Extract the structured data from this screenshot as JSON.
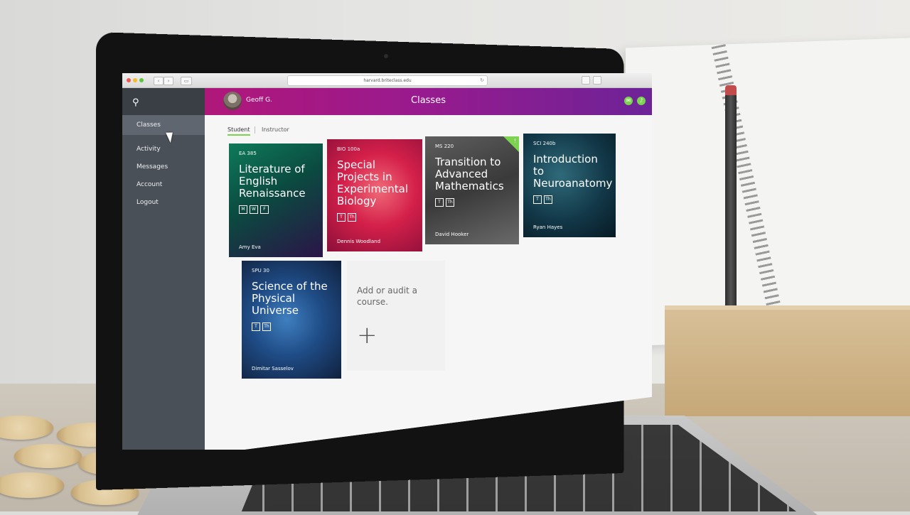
{
  "browser": {
    "url": "harvard.briteclass.edu"
  },
  "header": {
    "user_name": "Geoff G.",
    "title": "Classes"
  },
  "sidebar": {
    "items": [
      {
        "label": "Classes",
        "active": true
      },
      {
        "label": "Activity"
      },
      {
        "label": "Messages"
      },
      {
        "label": "Account"
      },
      {
        "label": "Logout"
      }
    ]
  },
  "tabs": [
    {
      "label": "Student",
      "active": true
    },
    {
      "label": "Instructor"
    }
  ],
  "courses": [
    {
      "code": "EA 385",
      "title": "Literature of English Renaissance",
      "days": [
        "M",
        "W",
        "F"
      ],
      "instructor": "Amy Eva"
    },
    {
      "code": "BIO 100a",
      "title": "Special Projects in Experimental Biology",
      "days": [
        "T",
        "Th"
      ],
      "instructor": "Dennis Woodland"
    },
    {
      "code": "MS 220",
      "title": "Transition to Advanced Mathematics",
      "days": [
        "T",
        "Th"
      ],
      "instructor": "David Hooker",
      "new": true
    },
    {
      "code": "SCI 240b",
      "title": "Introduction to Neuroanatomy",
      "days": [
        "T",
        "Th"
      ],
      "instructor": "Ryan Hayes"
    },
    {
      "code": "SPU 30",
      "title": "Science of the Physical Universe",
      "days": [
        "T",
        "Th"
      ],
      "instructor": "Dimitar Sasselov"
    }
  ],
  "add_course": {
    "text": "Add or audit a course.",
    "icon": "plus-icon"
  },
  "colors": {
    "header_start": "#b0177a",
    "header_end": "#6d2398",
    "accent_green": "#7bd350",
    "sidebar": "#4a5058"
  }
}
